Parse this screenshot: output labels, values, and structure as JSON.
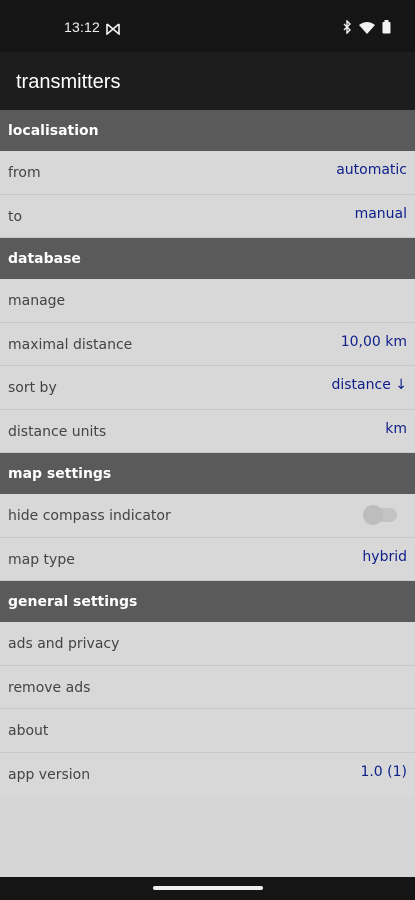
{
  "status_bar": {
    "time": "13:12"
  },
  "app_bar": {
    "title": "transmitters"
  },
  "sections": {
    "localisation": {
      "title": "localisation",
      "from_label": "from",
      "from_value": "automatic",
      "to_label": "to",
      "to_value": "manual"
    },
    "database": {
      "title": "database",
      "manage_label": "manage",
      "max_distance_label": "maximal distance",
      "max_distance_value": "10,00 km",
      "sort_by_label": "sort by",
      "sort_by_value": "distance ↓",
      "distance_units_label": "distance units",
      "distance_units_value": "km"
    },
    "map_settings": {
      "title": "map settings",
      "hide_compass_label": "hide compass indicator",
      "hide_compass_enabled": false,
      "map_type_label": "map type",
      "map_type_value": "hybrid"
    },
    "general_settings": {
      "title": "general settings",
      "ads_privacy_label": "ads and privacy",
      "remove_ads_label": "remove ads",
      "about_label": "about",
      "app_version_label": "app version",
      "app_version_value": "1.0 (1)"
    }
  },
  "colors": {
    "value_text": "#0e1f8a",
    "section_header_bg": "#5a5a5a",
    "app_bar_bg": "#1d1d1d",
    "list_bg": "#d8d8d8"
  }
}
